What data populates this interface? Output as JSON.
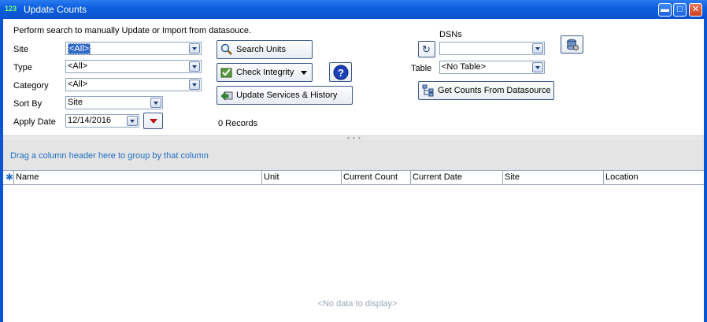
{
  "window": {
    "title": "Update Counts",
    "app_icon_text": "123"
  },
  "form": {
    "instruction": "Perform search to manually Update or Import from datasouce.",
    "site_label": "Site",
    "site_value": "<All>",
    "type_label": "Type",
    "type_value": "<All>",
    "category_label": "Category",
    "category_value": "<All>",
    "sortby_label": "Sort By",
    "sortby_value": "Site",
    "applydate_label": "Apply Date",
    "applydate_value": "12/14/2016",
    "search_units_label": "Search Units",
    "check_integrity_label": "Check Integrity",
    "update_services_label": "Update Services & History",
    "records_label": "0 Records",
    "dsns_label": "DSNs",
    "dsns_value": "",
    "table_label": "Table",
    "table_value": "<No Table>",
    "get_counts_label": "Get Counts From Datasource"
  },
  "grid": {
    "group_hint": "Drag a column header here to group by that column",
    "columns": [
      "Name",
      "Unit",
      "Current Count",
      "Current Date",
      "Site",
      "Location"
    ],
    "empty_text": "<No data to display>"
  },
  "colors": {
    "title_bar": "#0a54d6",
    "group_hint": "#1f6fc5",
    "selection": "#316ac5"
  }
}
